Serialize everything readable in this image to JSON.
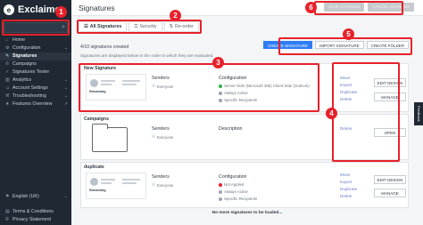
{
  "app": {
    "logo_text": "Exclaimer",
    "page_title": "Signatures"
  },
  "top_buttons": {
    "save": "SAVE CHANGES",
    "cancel": "CANCEL CHANGES"
  },
  "sidebar": {
    "items": [
      {
        "label": "Home",
        "icon": "home-icon"
      },
      {
        "label": "Configuration",
        "icon": "gear-icon",
        "chevron": "⌄"
      },
      {
        "label": "Signatures",
        "icon": "pen-icon",
        "active": true
      },
      {
        "label": "Campaigns",
        "icon": "megaphone-icon"
      },
      {
        "label": "Signatures Tester",
        "icon": "test-icon"
      },
      {
        "label": "Analytics",
        "icon": "chart-icon",
        "chevron": "⌄"
      },
      {
        "label": "Account Settings",
        "icon": "user-icon",
        "chevron": "⌄"
      },
      {
        "label": "Troubleshooting",
        "icon": "wrench-icon",
        "chevron": "⌄"
      },
      {
        "label": "Features Overview",
        "icon": "star-icon",
        "chevron": "↗"
      }
    ],
    "language": "English (UK)",
    "terms": "Terms & Conditions",
    "privacy": "Privacy Statement"
  },
  "tabs": [
    {
      "label": "All Signatures",
      "icon": "☰"
    },
    {
      "label": "Security",
      "icon": "⚿"
    },
    {
      "label": "Re-order",
      "icon": "⇅"
    }
  ],
  "list": {
    "count_text": "4/10 signatures created",
    "note": "Signatures are displayed below in the order in which they are evaluated."
  },
  "actions": {
    "create_signature": "CREATE SIGNATURE",
    "import_signature": "IMPORT SIGNATURE",
    "create_folder": "CREATE FOLDER"
  },
  "columns": {
    "senders": "Senders",
    "configuration": "Configuration",
    "description": "Description"
  },
  "cards": [
    {
      "name": "New Signature",
      "thumb_name": "Streaming",
      "senders": "Everyone",
      "config": [
        {
          "text": "Server-Side (Microsoft 365) Client-Side (Outlook)",
          "color": "#2bb24c"
        },
        {
          "text": "Always Active",
          "color": "#9aa3ad"
        },
        {
          "text": "Specific Recipients",
          "color": "#9aa3ad"
        }
      ],
      "links": [
        "Move",
        "Export",
        "Duplicate",
        "Delete"
      ],
      "buttons": [
        "EDIT DESIGN",
        "MANAGE"
      ]
    },
    {
      "name": "Campaigns",
      "senders": "Everyone",
      "links": [
        "Delete"
      ],
      "buttons": [
        "OPEN"
      ]
    },
    {
      "name": "duplicate",
      "thumb_name": "Streaming",
      "senders": "Everyone",
      "config": [
        {
          "text": "Not Applied",
          "color": "#e8212a"
        },
        {
          "text": "Always Active",
          "color": "#9aa3ad"
        },
        {
          "text": "Specific Recipients",
          "color": "#9aa3ad"
        }
      ],
      "links": [
        "Move",
        "Export",
        "Duplicate",
        "Delete"
      ],
      "buttons": [
        "EDIT DESIGN",
        "MANAGE"
      ]
    }
  ],
  "no_more": "No more signatures to be loaded...",
  "feedback": "Feedback",
  "badges": [
    "1",
    "2",
    "3",
    "4",
    "5",
    "6"
  ]
}
